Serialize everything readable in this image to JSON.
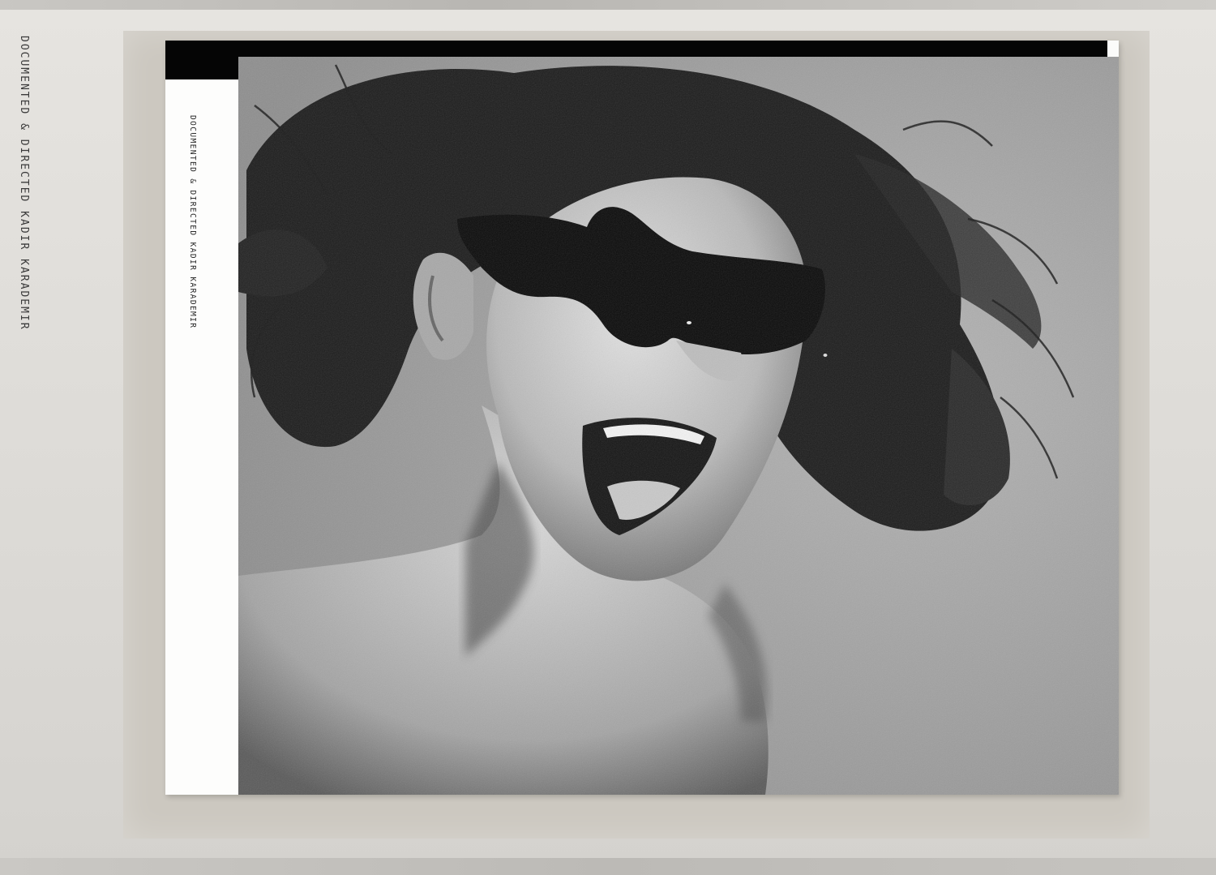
{
  "left_caption": "DOCUMENTED & DIRECTED  KADIR KARADEMIR",
  "inner_caption": "DOCUMENTED & DIRECTED  KADIR KARADEMIR",
  "photo": {
    "subject": "black-and-white portrait of screaming woman wearing black sunglasses",
    "palette": "grayscale"
  }
}
